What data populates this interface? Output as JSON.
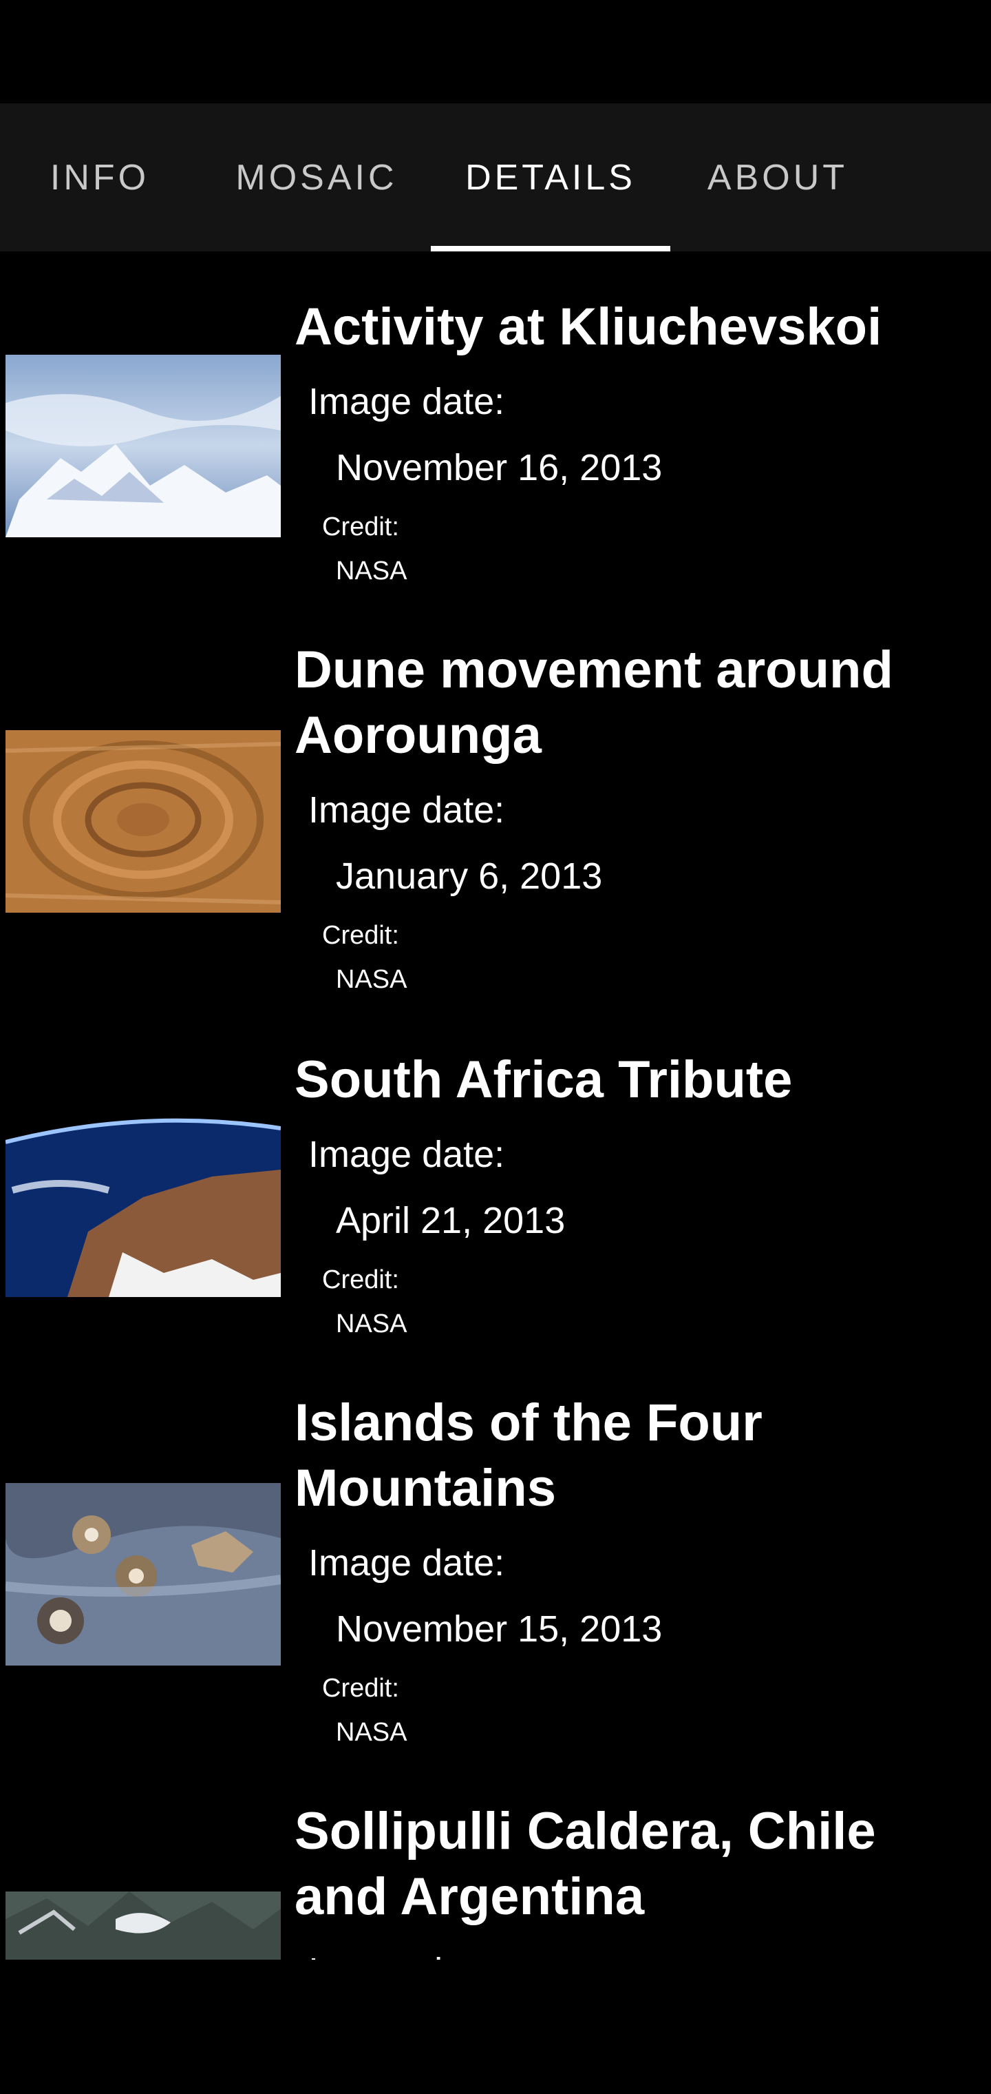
{
  "tabs": [
    {
      "label": "INFO"
    },
    {
      "label": "MOSAIC"
    },
    {
      "label": "DETAILS"
    },
    {
      "label": "ABOUT"
    }
  ],
  "active_tab": "DETAILS",
  "items": [
    {
      "title": "Activity at Kliuchevskoi",
      "date_label": "Image date:",
      "date": "November 16, 2013",
      "credit_label": "Credit:",
      "credit": "NASA"
    },
    {
      "title": "Dune movement around Aorounga",
      "date_label": "Image date:",
      "date": "January 6, 2013",
      "credit_label": "Credit:",
      "credit": "NASA"
    },
    {
      "title": "South Africa Tribute",
      "date_label": "Image date:",
      "date": "April 21, 2013",
      "credit_label": "Credit:",
      "credit": "NASA"
    },
    {
      "title": "Islands of the Four Mountains",
      "date_label": "Image date:",
      "date": "November 15, 2013",
      "credit_label": "Credit:",
      "credit": "NASA"
    },
    {
      "title": "Sollipulli Caldera, Chile and Argentina",
      "date_label": "Image date:"
    }
  ]
}
